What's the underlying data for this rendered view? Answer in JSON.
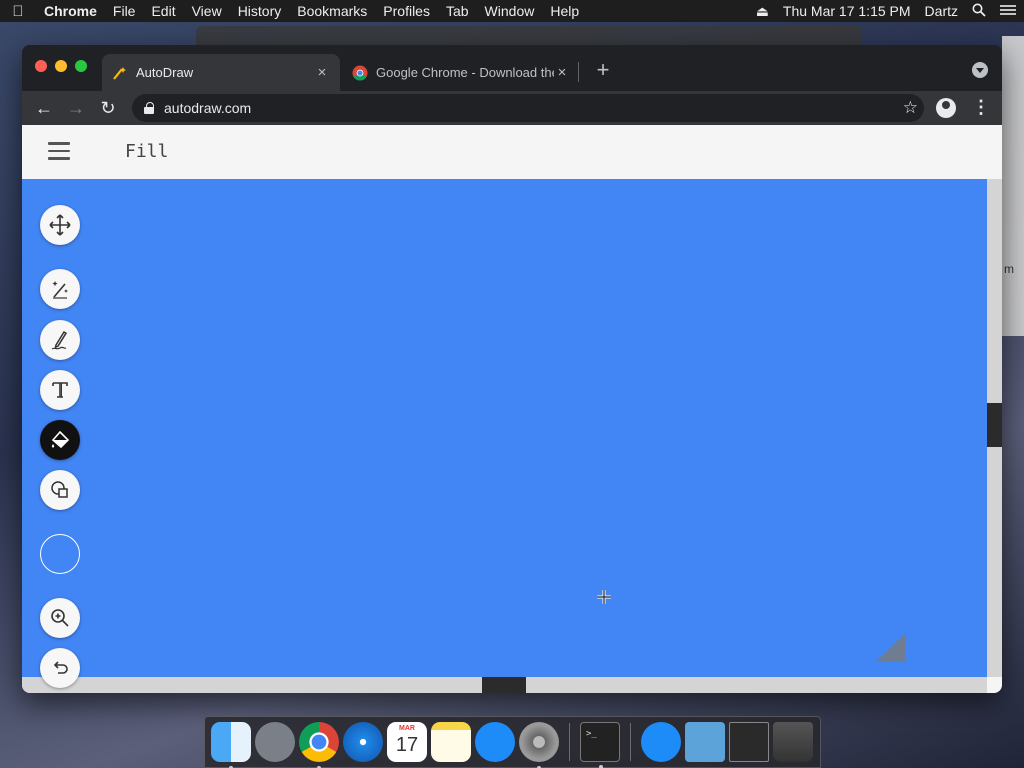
{
  "menubar": {
    "app": "Chrome",
    "items": [
      "File",
      "Edit",
      "View",
      "History",
      "Bookmarks",
      "Profiles",
      "Tab",
      "Window",
      "Help"
    ],
    "datetime": "Thu Mar 17  1:15 PM",
    "user": "Dartz"
  },
  "background_window": {
    "partial_text": "m"
  },
  "browser": {
    "tabs": [
      {
        "title": "AutoDraw",
        "favicon": "autodraw-icon",
        "active": true,
        "close": "×"
      },
      {
        "title": "Google Chrome - Download the",
        "favicon": "chrome-icon",
        "active": false,
        "close": "×"
      }
    ],
    "new_tab": "+",
    "nav": {
      "back": "←",
      "forward": "→",
      "reload": "↻"
    },
    "url": "autodraw.com",
    "star": "☆",
    "menu": "⋮"
  },
  "autodraw": {
    "mode_label": "Fill",
    "tools": [
      {
        "name": "move-tool",
        "icon": "move-icon",
        "active": false
      },
      {
        "name": "autodraw-tool",
        "icon": "magic-pen-icon",
        "active": false
      },
      {
        "name": "draw-tool",
        "icon": "pencil-icon",
        "active": false
      },
      {
        "name": "type-tool",
        "icon": "text-icon",
        "active": false
      },
      {
        "name": "fill-tool",
        "icon": "paint-bucket-icon",
        "active": true
      },
      {
        "name": "shape-tool",
        "icon": "shapes-icon",
        "active": false
      },
      {
        "name": "color-picker",
        "icon": "color-swatch-icon",
        "active": false
      },
      {
        "name": "zoom-tool",
        "icon": "zoom-icon",
        "active": false
      },
      {
        "name": "undo-tool",
        "icon": "undo-icon",
        "active": false
      }
    ],
    "canvas_color": "#4285f4",
    "selected_color": "#4285f4"
  },
  "dock": {
    "apps": [
      "Finder",
      "Launchpad",
      "Google Chrome",
      "Safari",
      "Calendar",
      "Notes",
      "App Store",
      "System Preferences",
      "Terminal",
      "Applications",
      "Folder",
      "Preview",
      "Trash"
    ],
    "calendar_month": "MAR",
    "calendar_day": "17",
    "terminal_prompt": ">_"
  }
}
